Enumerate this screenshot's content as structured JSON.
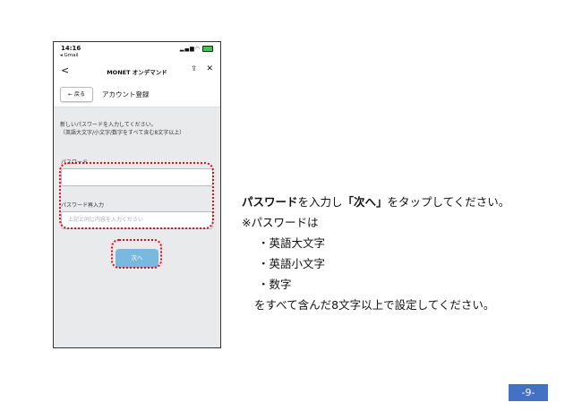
{
  "status_bar": {
    "time": "14:16",
    "back_app": "◂ Gmail"
  },
  "nav": {
    "back": "<",
    "title": "MONET オンデマンド",
    "share": "⇪",
    "close": "✕"
  },
  "page_header": {
    "back_button": "← 戻る",
    "title": "アカウント登録"
  },
  "form": {
    "instruction_1": "新しいパスワードを入力してください。",
    "instruction_2": "（英語大文字/小文字/数字をすべて含む8文字以上）",
    "password_label": "パスワード",
    "password_value": "",
    "confirm_label": "パスワード再入力",
    "confirm_placeholder": "上記と同じ内容を入力ください",
    "next_button": "次へ"
  },
  "right_text": {
    "l1_bold1": "パスワード",
    "l1_a": "を入力し",
    "l1_bold2": "「次へ」",
    "l1_b": "をタップしてください。",
    "l2": "※パスワードは",
    "l3": "・英語大文字",
    "l4": "・英語小文字",
    "l5": "・数字",
    "l6": "をすべて含んだ8文字以上で設定してください。"
  },
  "page_number": "-9-",
  "colors": {
    "highlight": "#d0141c",
    "button": "#7ab9df",
    "page_badge": "#4471c4"
  }
}
